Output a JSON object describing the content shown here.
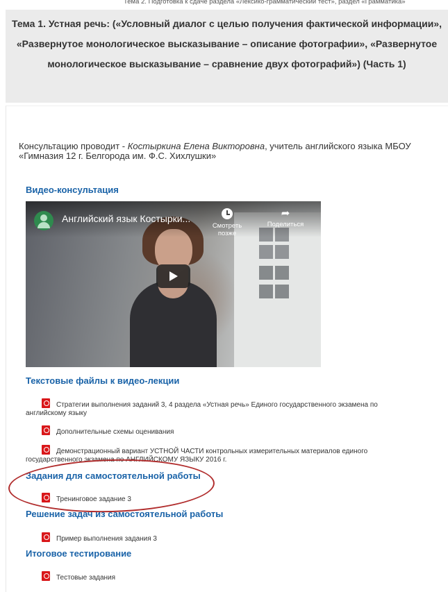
{
  "header": {
    "prev_topic_cut": "Тема 2. Подготовка к сдаче раздела «Лексико-грамматический тест», раздел «Грамматика»",
    "topic_title": "Тема 1. Устная речь: («Условный диалог с целью получения фактической информации», «Развернутое монологическое высказывание – описание фотографии», «Развернутое монологическое высказывание – сравнение двух фотографий») (Часть 1)"
  },
  "intro": {
    "prefix": "Консультацию проводит - ",
    "teacher": "Костыркина Елена Викторовна",
    "suffix": ", учитель английского языка МБОУ «Гимназия 12 г. Белгорода им. Ф.С. Хихлушки»"
  },
  "video_section": {
    "heading": "Видео-консультация",
    "video": {
      "title": "Английский язык Костырки...",
      "watch_later": "Смотреть позже",
      "share": "Поделиться",
      "icons": [
        "avatar-icon",
        "clock-icon",
        "share-icon",
        "play-icon"
      ]
    }
  },
  "text_files": {
    "heading": "Текстовые файлы к видео-лекции",
    "items": [
      "Стратегии выполнения заданий 3, 4 раздела «Устная речь» Единого государственного экзамена по английскому языку",
      "Дополнительные схемы оценивания",
      "Демонстрационный вариант УСТНОЙ ЧАСТИ контрольных измерительных материалов единого государственного экзамена по АНГЛИЙСКОМУ ЯЗЫКУ 2016 г."
    ]
  },
  "self_work": {
    "heading": "Задания для самостоятельной работы",
    "items": [
      "Тренинговое задание 3"
    ]
  },
  "solutions": {
    "heading": "Решение задач из самостоятельной работы",
    "items": [
      "Пример выполнения задания 3"
    ]
  },
  "final_test": {
    "heading": "Итоговое тестирование",
    "items": [
      "Тестовые задания"
    ]
  },
  "colors": {
    "heading": "#1a63a8",
    "topic_bg": "#ebebeb",
    "pdf_icon": "#d9171a",
    "highlight_oval": "#b12d2d"
  }
}
